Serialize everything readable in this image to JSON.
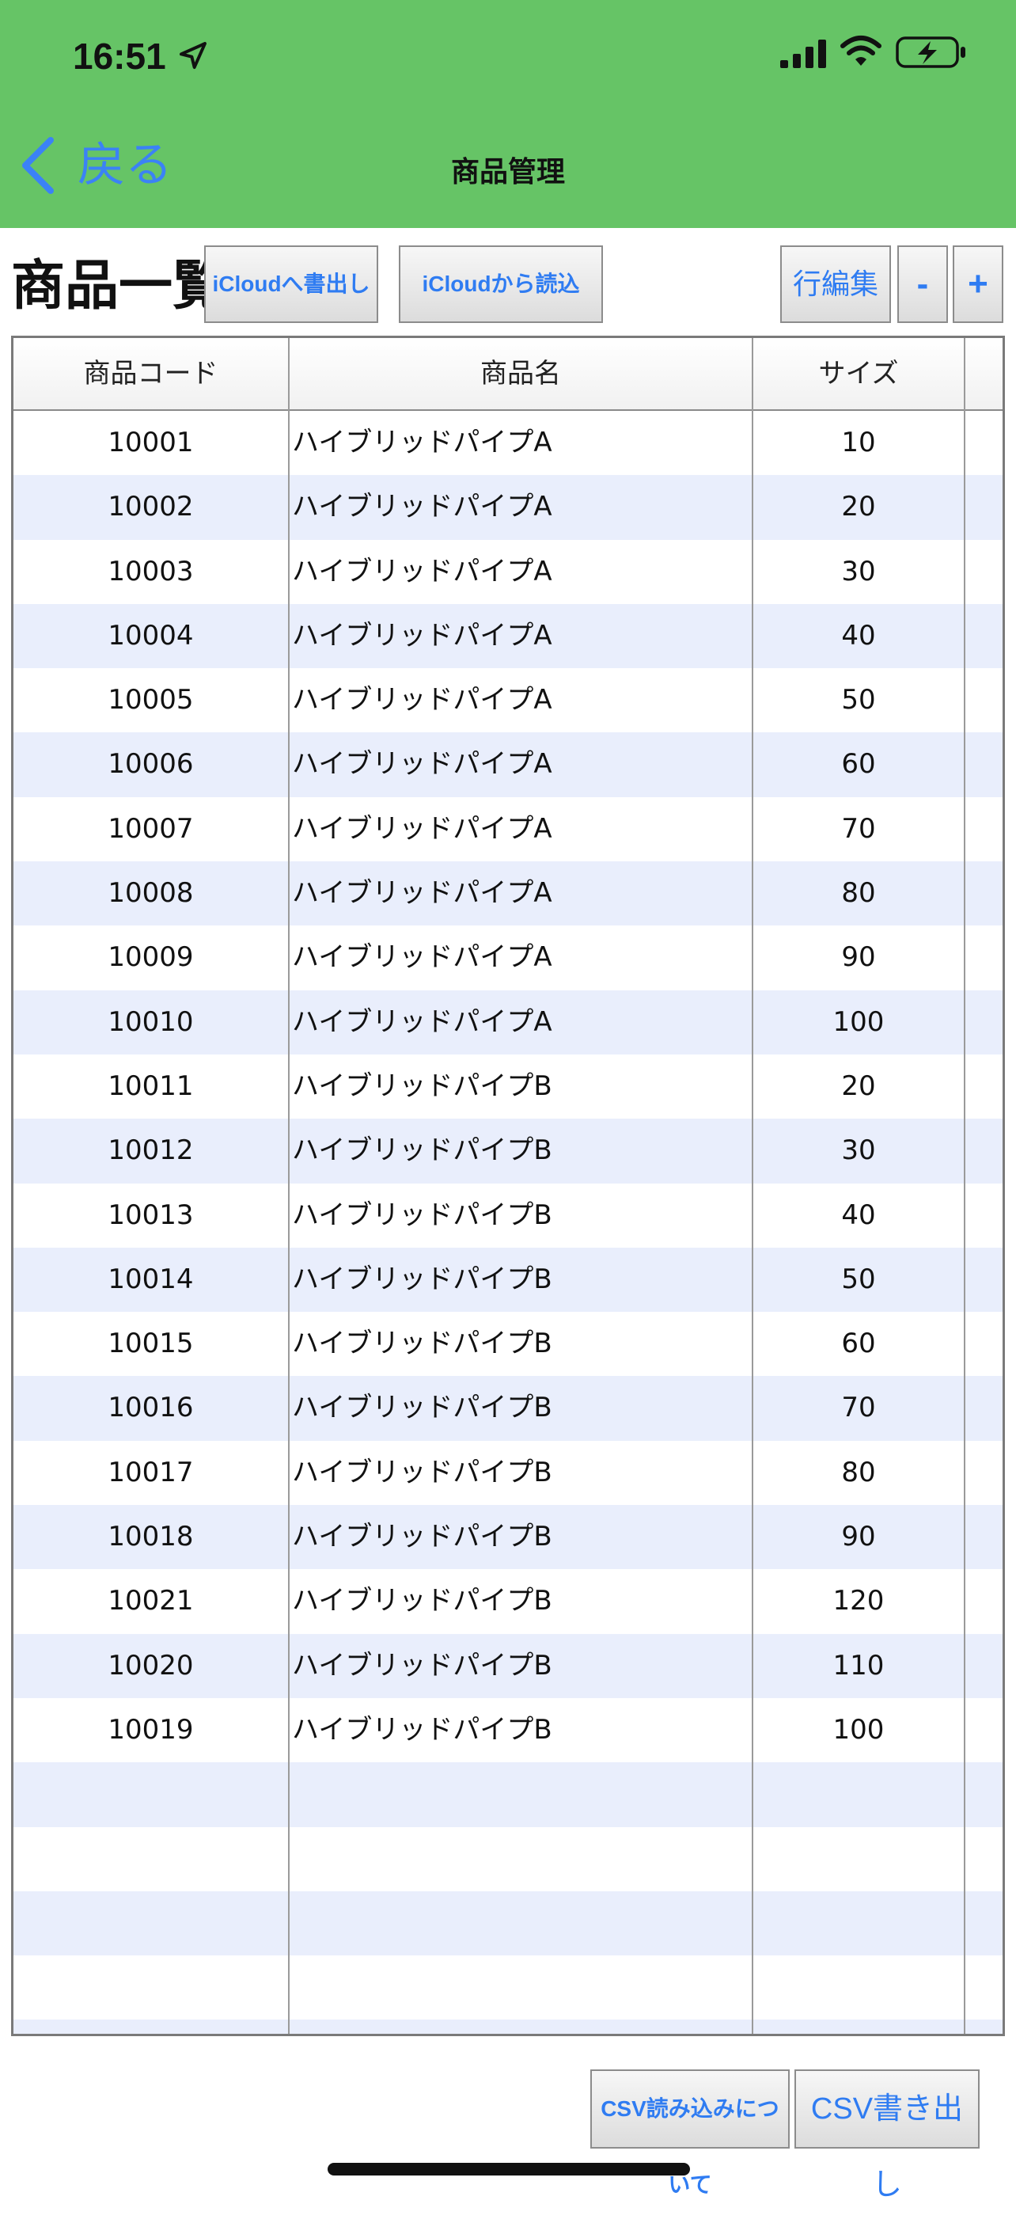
{
  "status_bar": {
    "time": "16:51"
  },
  "nav": {
    "back_label": "戻る",
    "title": "商品管理"
  },
  "toolbar": {
    "page_title": "商品一覧",
    "icloud_export": "iCloudへ書出し",
    "icloud_import": "iCloudから読込",
    "row_edit": "行編集",
    "minus": "-",
    "plus": "+"
  },
  "table": {
    "headers": {
      "code": "商品コード",
      "name": "商品名",
      "size": "サイズ"
    },
    "rows": [
      {
        "code": "10001",
        "name": "ハイブリッドパイプA",
        "size": "10"
      },
      {
        "code": "10002",
        "name": "ハイブリッドパイプA",
        "size": "20"
      },
      {
        "code": "10003",
        "name": "ハイブリッドパイプA",
        "size": "30"
      },
      {
        "code": "10004",
        "name": "ハイブリッドパイプA",
        "size": "40"
      },
      {
        "code": "10005",
        "name": "ハイブリッドパイプA",
        "size": "50"
      },
      {
        "code": "10006",
        "name": "ハイブリッドパイプA",
        "size": "60"
      },
      {
        "code": "10007",
        "name": "ハイブリッドパイプA",
        "size": "70"
      },
      {
        "code": "10008",
        "name": "ハイブリッドパイプA",
        "size": "80"
      },
      {
        "code": "10009",
        "name": "ハイブリッドパイプA",
        "size": "90"
      },
      {
        "code": "10010",
        "name": "ハイブリッドパイプA",
        "size": "100"
      },
      {
        "code": "10011",
        "name": "ハイブリッドパイプB",
        "size": "20"
      },
      {
        "code": "10012",
        "name": "ハイブリッドパイプB",
        "size": "30"
      },
      {
        "code": "10013",
        "name": "ハイブリッドパイプB",
        "size": "40"
      },
      {
        "code": "10014",
        "name": "ハイブリッドパイプB",
        "size": "50"
      },
      {
        "code": "10015",
        "name": "ハイブリッドパイプB",
        "size": "60"
      },
      {
        "code": "10016",
        "name": "ハイブリッドパイプB",
        "size": "70"
      },
      {
        "code": "10017",
        "name": "ハイブリッドパイプB",
        "size": "80"
      },
      {
        "code": "10018",
        "name": "ハイブリッドパイプB",
        "size": "90"
      },
      {
        "code": "10021",
        "name": "ハイブリッドパイプB",
        "size": "120"
      },
      {
        "code": "10020",
        "name": "ハイブリッドパイプB",
        "size": "110"
      },
      {
        "code": "10019",
        "name": "ハイブリッドパイプB",
        "size": "100"
      },
      {
        "code": "",
        "name": "",
        "size": ""
      },
      {
        "code": "",
        "name": "",
        "size": ""
      },
      {
        "code": "",
        "name": "",
        "size": ""
      },
      {
        "code": "",
        "name": "",
        "size": ""
      },
      {
        "code": "",
        "name": "",
        "size": ""
      }
    ]
  },
  "footer": {
    "csv_about": "CSV読み込みについて",
    "csv_export": "CSV書き出し"
  },
  "colors": {
    "nav_bg": "#66c466",
    "accent": "#2f7cf2",
    "row_alt": "#e9eefc"
  }
}
